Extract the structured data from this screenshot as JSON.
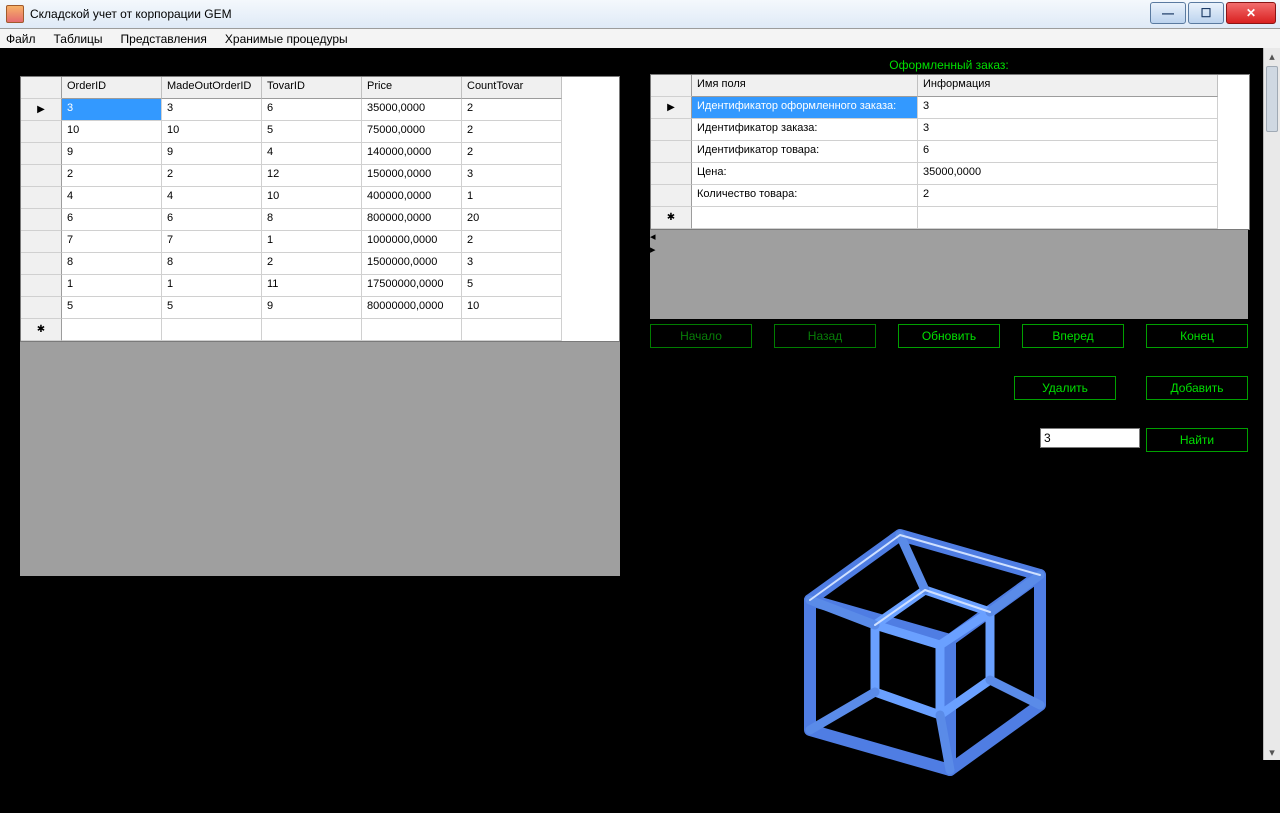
{
  "window": {
    "title": "Складской учет от корпорации GEM"
  },
  "menu": {
    "file": "Файл",
    "tables": "Таблицы",
    "views": "Представления",
    "procs": "Хранимые процедуры"
  },
  "left_grid": {
    "headers": [
      "OrderID",
      "MadeOutOrderID",
      "TovarID",
      "Price",
      "CountTovar"
    ],
    "rows": [
      [
        "3",
        "3",
        "6",
        "35000,0000",
        "2"
      ],
      [
        "10",
        "10",
        "5",
        "75000,0000",
        "2"
      ],
      [
        "9",
        "9",
        "4",
        "140000,0000",
        "2"
      ],
      [
        "2",
        "2",
        "12",
        "150000,0000",
        "3"
      ],
      [
        "4",
        "4",
        "10",
        "400000,0000",
        "1"
      ],
      [
        "6",
        "6",
        "8",
        "800000,0000",
        "20"
      ],
      [
        "7",
        "7",
        "1",
        "1000000,0000",
        "2"
      ],
      [
        "8",
        "8",
        "2",
        "1500000,0000",
        "3"
      ],
      [
        "1",
        "1",
        "11",
        "17500000,0000",
        "5"
      ],
      [
        "5",
        "5",
        "9",
        "80000000,0000",
        "10"
      ]
    ]
  },
  "right_title": "Оформленный заказ:",
  "right_grid": {
    "headers": [
      "Имя поля",
      "Информация"
    ],
    "rows": [
      [
        "Идентификатор оформленного заказа:",
        "3"
      ],
      [
        "Идентификатор заказа:",
        "3"
      ],
      [
        "Идентификатор товара:",
        "6"
      ],
      [
        "Цена:",
        "35000,0000"
      ],
      [
        "Количество товара:",
        "2"
      ]
    ]
  },
  "buttons": {
    "begin": "Начало",
    "back": "Назад",
    "refresh": "Обновить",
    "forward": "Вперед",
    "end": "Конец",
    "delete": "Удалить",
    "add": "Добавить",
    "find": "Найти"
  },
  "search_value": "3",
  "glyphs": {
    "arrow_right": "▶",
    "asterisk": "✱",
    "arrow_left_s": "◂",
    "arrow_right_s": "▸",
    "arrow_up_s": "▴",
    "arrow_down_s": "▾",
    "min": "—",
    "max": "☐",
    "close": "✕"
  }
}
